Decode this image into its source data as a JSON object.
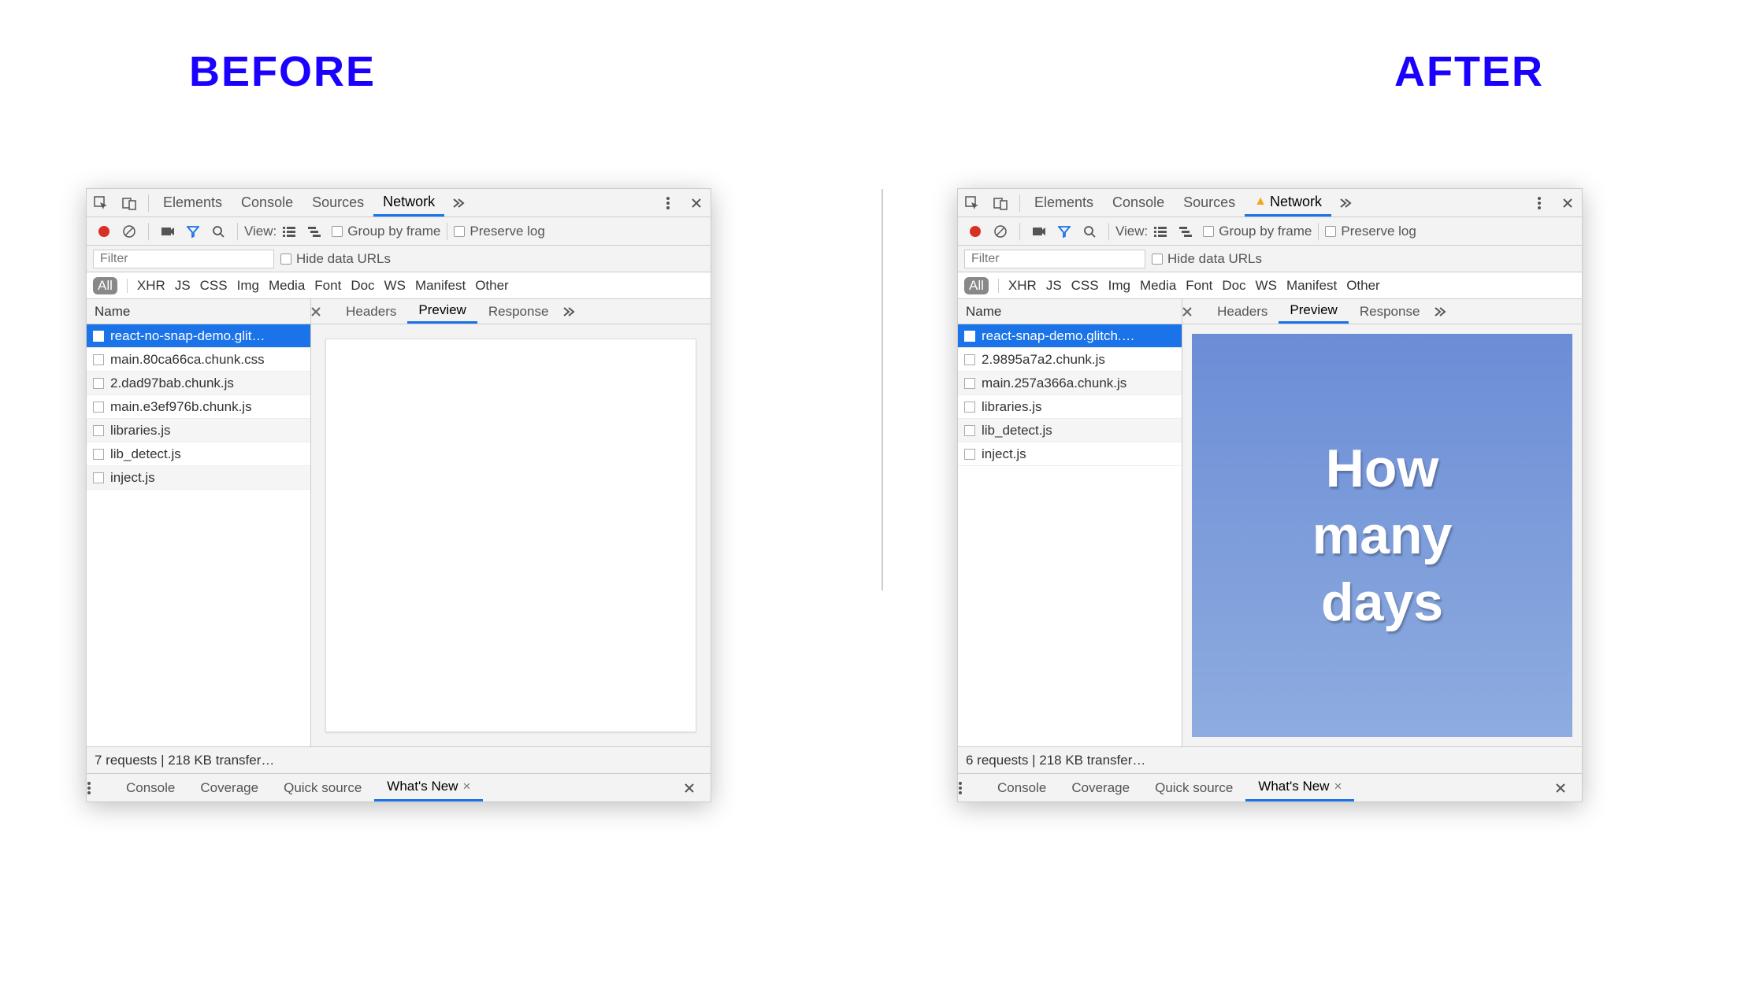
{
  "titles": {
    "before": "BEFORE",
    "after": "AFTER"
  },
  "tabs": {
    "elements": "Elements",
    "console": "Console",
    "sources": "Sources",
    "network": "Network"
  },
  "toolbar": {
    "view": "View:",
    "group_by_frame": "Group by frame",
    "preserve_log": "Preserve log",
    "hide_data_urls": "Hide data URLs",
    "filter_placeholder": "Filter"
  },
  "chips": [
    "All",
    "XHR",
    "JS",
    "CSS",
    "Img",
    "Media",
    "Font",
    "Doc",
    "WS",
    "Manifest",
    "Other"
  ],
  "cols": {
    "name": "Name"
  },
  "detail_tabs": {
    "headers": "Headers",
    "preview": "Preview",
    "response": "Response"
  },
  "drawer": {
    "console": "Console",
    "coverage": "Coverage",
    "quick_source": "Quick source",
    "whats_new": "What's New"
  },
  "before": {
    "requests": [
      "react-no-snap-demo.glit…",
      "main.80ca66ca.chunk.css",
      "2.dad97bab.chunk.js",
      "main.e3ef976b.chunk.js",
      "libraries.js",
      "lib_detect.js",
      "inject.js"
    ],
    "status": "7 requests | 218 KB transfer…",
    "preview_text": ""
  },
  "after": {
    "requests": [
      "react-snap-demo.glitch.…",
      "2.9895a7a2.chunk.js",
      "main.257a366a.chunk.js",
      "libraries.js",
      "lib_detect.js",
      "inject.js"
    ],
    "status": "6 requests | 218 KB transfer…",
    "preview_text": "How\nmany\ndays"
  }
}
